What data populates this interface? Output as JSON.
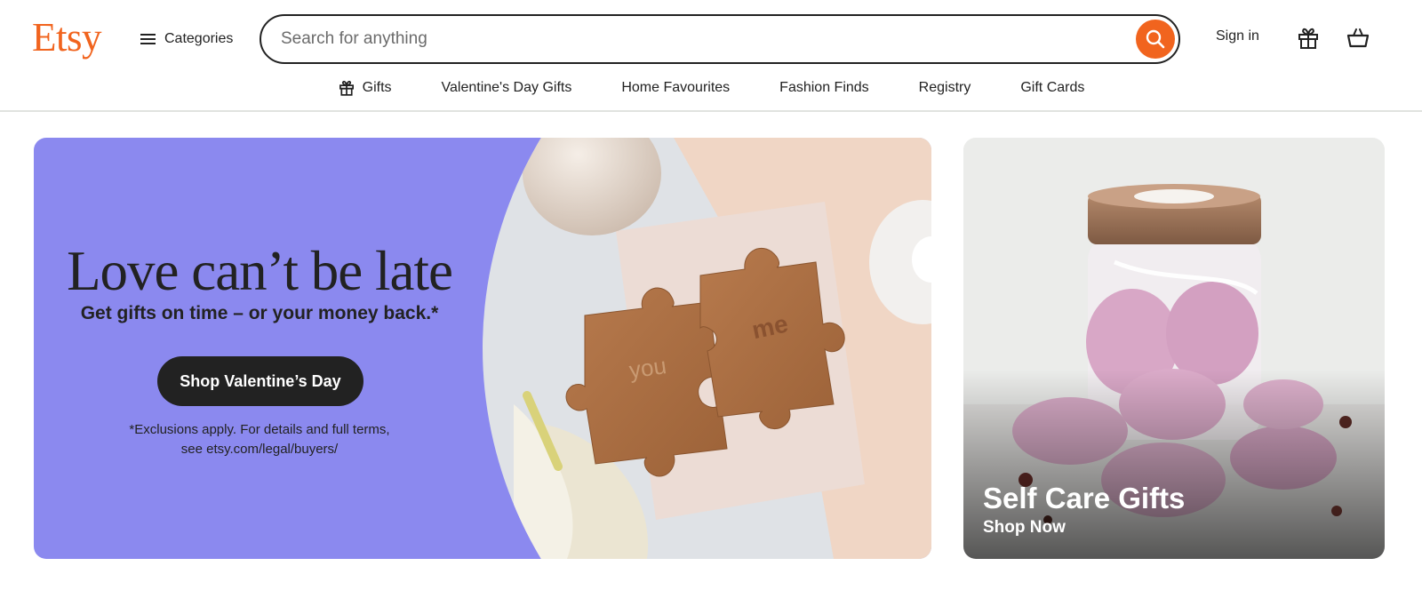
{
  "header": {
    "logo": "Etsy",
    "categories_label": "Categories",
    "search_placeholder": "Search for anything",
    "signin_label": "Sign in"
  },
  "nav": {
    "items": [
      {
        "label": "Gifts",
        "icon": "gift-icon"
      },
      {
        "label": "Valentine's Day Gifts"
      },
      {
        "label": "Home Favourites"
      },
      {
        "label": "Fashion Finds"
      },
      {
        "label": "Registry"
      },
      {
        "label": "Gift Cards"
      }
    ]
  },
  "hero": {
    "title": "Love can’t be late",
    "subtitle": "Get gifts on time – or your money back.*",
    "button_label": "Shop Valentine’s Day",
    "fine_print": "*Exclusions apply. For details and full terms, see etsy.com/legal/buyers/",
    "puzzle_left_text": "you",
    "puzzle_right_text": "me"
  },
  "promo": {
    "title": "Self Care Gifts",
    "link_label": "Shop Now"
  },
  "colors": {
    "brand": "#f1641e",
    "hero_bg": "#8b89ef",
    "dark": "#222222"
  },
  "icons": [
    "hamburger-icon",
    "search-icon",
    "gift-icon",
    "shopping-basket-icon"
  ]
}
